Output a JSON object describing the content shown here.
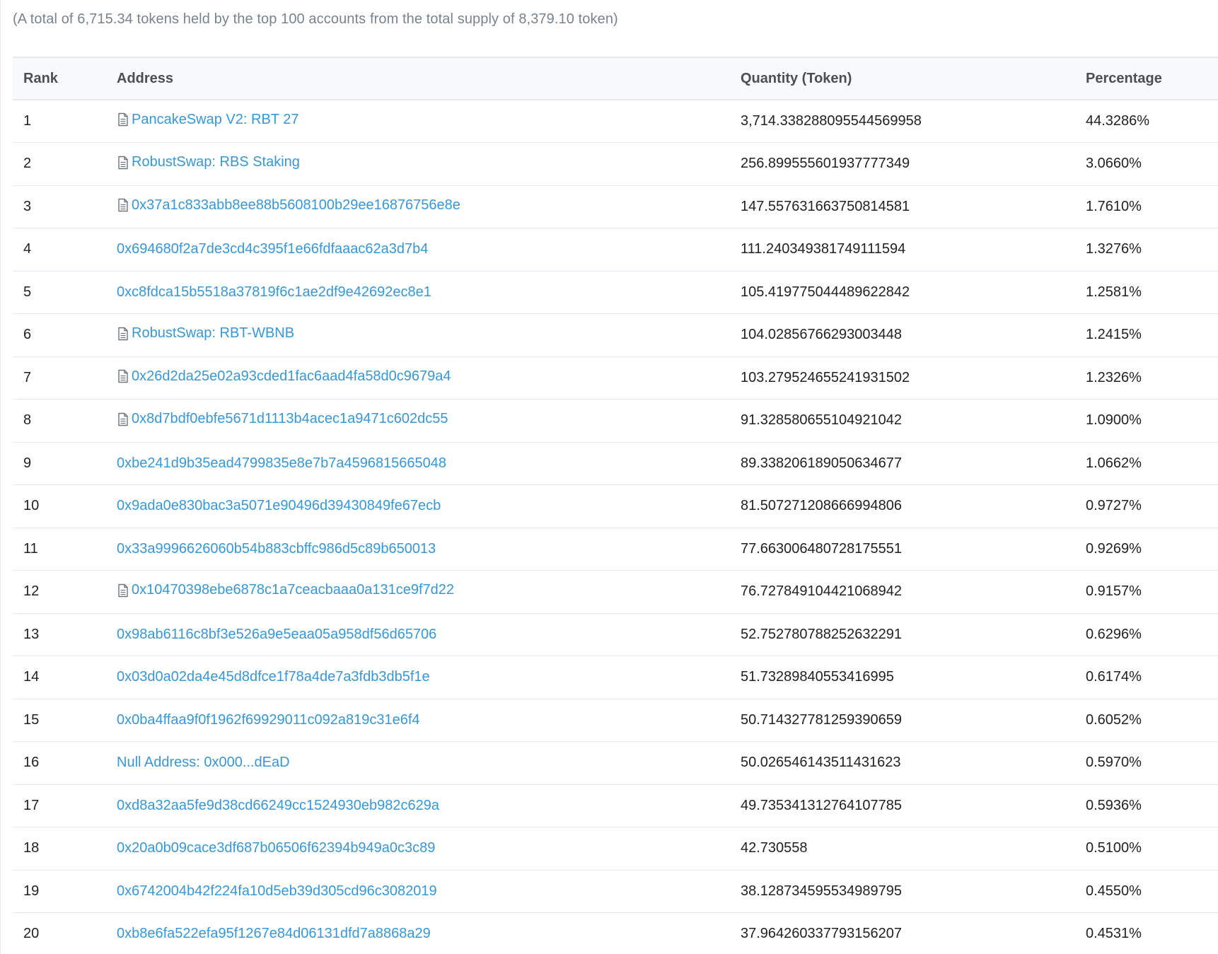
{
  "summary": "(A total of 6,715.34 tokens held by the top 100 accounts from the total supply of 8,379.10 token)",
  "table": {
    "headers": {
      "rank": "Rank",
      "address": "Address",
      "quantity": "Quantity (Token)",
      "percentage": "Percentage"
    },
    "rows": [
      {
        "rank": "1",
        "address": "PancakeSwap V2: RBT 27",
        "contract": true,
        "quantity": "3,714.338288095544569958",
        "percentage": "44.3286%"
      },
      {
        "rank": "2",
        "address": "RobustSwap: RBS Staking",
        "contract": true,
        "quantity": "256.899555601937777349",
        "percentage": "3.0660%"
      },
      {
        "rank": "3",
        "address": "0x37a1c833abb8ee88b5608100b29ee16876756e8e",
        "contract": true,
        "quantity": "147.557631663750814581",
        "percentage": "1.7610%"
      },
      {
        "rank": "4",
        "address": "0x694680f2a7de3cd4c395f1e66fdfaaac62a3d7b4",
        "contract": false,
        "quantity": "111.240349381749111594",
        "percentage": "1.3276%"
      },
      {
        "rank": "5",
        "address": "0xc8fdca15b5518a37819f6c1ae2df9e42692ec8e1",
        "contract": false,
        "quantity": "105.419775044489622842",
        "percentage": "1.2581%"
      },
      {
        "rank": "6",
        "address": "RobustSwap: RBT-WBNB",
        "contract": true,
        "quantity": "104.02856766293003448",
        "percentage": "1.2415%"
      },
      {
        "rank": "7",
        "address": "0x26d2da25e02a93cded1fac6aad4fa58d0c9679a4",
        "contract": true,
        "quantity": "103.279524655241931502",
        "percentage": "1.2326%"
      },
      {
        "rank": "8",
        "address": "0x8d7bdf0ebfe5671d1113b4acec1a9471c602dc55",
        "contract": true,
        "quantity": "91.328580655104921042",
        "percentage": "1.0900%"
      },
      {
        "rank": "9",
        "address": "0xbe241d9b35ead4799835e8e7b7a4596815665048",
        "contract": false,
        "quantity": "89.338206189050634677",
        "percentage": "1.0662%"
      },
      {
        "rank": "10",
        "address": "0x9ada0e830bac3a5071e90496d39430849fe67ecb",
        "contract": false,
        "quantity": "81.507271208666994806",
        "percentage": "0.9727%"
      },
      {
        "rank": "11",
        "address": "0x33a9996626060b54b883cbffc986d5c89b650013",
        "contract": false,
        "quantity": "77.663006480728175551",
        "percentage": "0.9269%"
      },
      {
        "rank": "12",
        "address": "0x10470398ebe6878c1a7ceacbaaa0a131ce9f7d22",
        "contract": true,
        "quantity": "76.727849104421068942",
        "percentage": "0.9157%"
      },
      {
        "rank": "13",
        "address": "0x98ab6116c8bf3e526a9e5eaa05a958df56d65706",
        "contract": false,
        "quantity": "52.752780788252632291",
        "percentage": "0.6296%"
      },
      {
        "rank": "14",
        "address": "0x03d0a02da4e45d8dfce1f78a4de7a3fdb3db5f1e",
        "contract": false,
        "quantity": "51.73289840553416995",
        "percentage": "0.6174%"
      },
      {
        "rank": "15",
        "address": "0x0ba4ffaa9f0f1962f69929011c092a819c31e6f4",
        "contract": false,
        "quantity": "50.714327781259390659",
        "percentage": "0.6052%"
      },
      {
        "rank": "16",
        "address": "Null Address: 0x000...dEaD",
        "contract": false,
        "quantity": "50.026546143511431623",
        "percentage": "0.5970%"
      },
      {
        "rank": "17",
        "address": "0xd8a32aa5fe9d38cd66249cc1524930eb982c629a",
        "contract": false,
        "quantity": "49.735341312764107785",
        "percentage": "0.5936%"
      },
      {
        "rank": "18",
        "address": "0x20a0b09cace3df687b06506f62394b949a0c3c89",
        "contract": false,
        "quantity": "42.730558",
        "percentage": "0.5100%"
      },
      {
        "rank": "19",
        "address": "0x6742004b42f224fa10d5eb39d305cd96c3082019",
        "contract": false,
        "quantity": "38.128734595534989795",
        "percentage": "0.4550%"
      },
      {
        "rank": "20",
        "address": "0xb8e6fa522efa95f1267e84d06131dfd7a8868a29",
        "contract": false,
        "quantity": "37.964260337793156207",
        "percentage": "0.4531%"
      }
    ]
  },
  "colors": {
    "link": "#3498db",
    "muted_text": "#77838f",
    "header_bg": "#f8f9fa",
    "border": "#e7eaf3"
  },
  "icons": {
    "contract": "file-document-icon"
  }
}
